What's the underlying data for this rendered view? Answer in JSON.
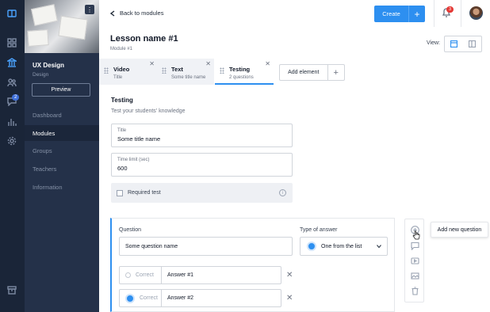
{
  "rail": {
    "badge": "2"
  },
  "sidebar": {
    "course_title": "UX Design",
    "course_subtitle": "Design",
    "preview_label": "Preview",
    "items": [
      {
        "label": "Dashboard"
      },
      {
        "label": "Modules"
      },
      {
        "label": "Groups"
      },
      {
        "label": "Teachers"
      },
      {
        "label": "Information"
      }
    ]
  },
  "header": {
    "back_label": "Back to modules",
    "create_label": "Create",
    "notification_count": "3"
  },
  "page": {
    "title": "Lesson name #1",
    "subtitle": "Module #1",
    "view_label": "View:"
  },
  "tabs": [
    {
      "name": "Video",
      "sub": "Title"
    },
    {
      "name": "Text",
      "sub": "Some title name"
    },
    {
      "name": "Testing",
      "sub": "2 questions"
    }
  ],
  "add_element_label": "Add element",
  "testing": {
    "title": "Testing",
    "subtitle": "Test your students' knowledge",
    "title_field": {
      "label": "Title",
      "value": "Some title name"
    },
    "time_field": {
      "label": "Time limit (sec)",
      "value": "600"
    },
    "required_label": "Required test"
  },
  "question": {
    "question_label": "Question",
    "question_value": "Some question name",
    "type_label": "Type of answer",
    "type_value": "One from the list",
    "answers": [
      {
        "correct_label": "Correct",
        "text": "Answer #1",
        "selected": false
      },
      {
        "correct_label": "Correct",
        "text": "Answer #2",
        "selected": true
      }
    ]
  },
  "tooltip": "Add new question",
  "colors": {
    "accent": "#2d8ff0",
    "rail": "#1a2538",
    "sidebar": "#243149",
    "danger": "#e53935"
  }
}
